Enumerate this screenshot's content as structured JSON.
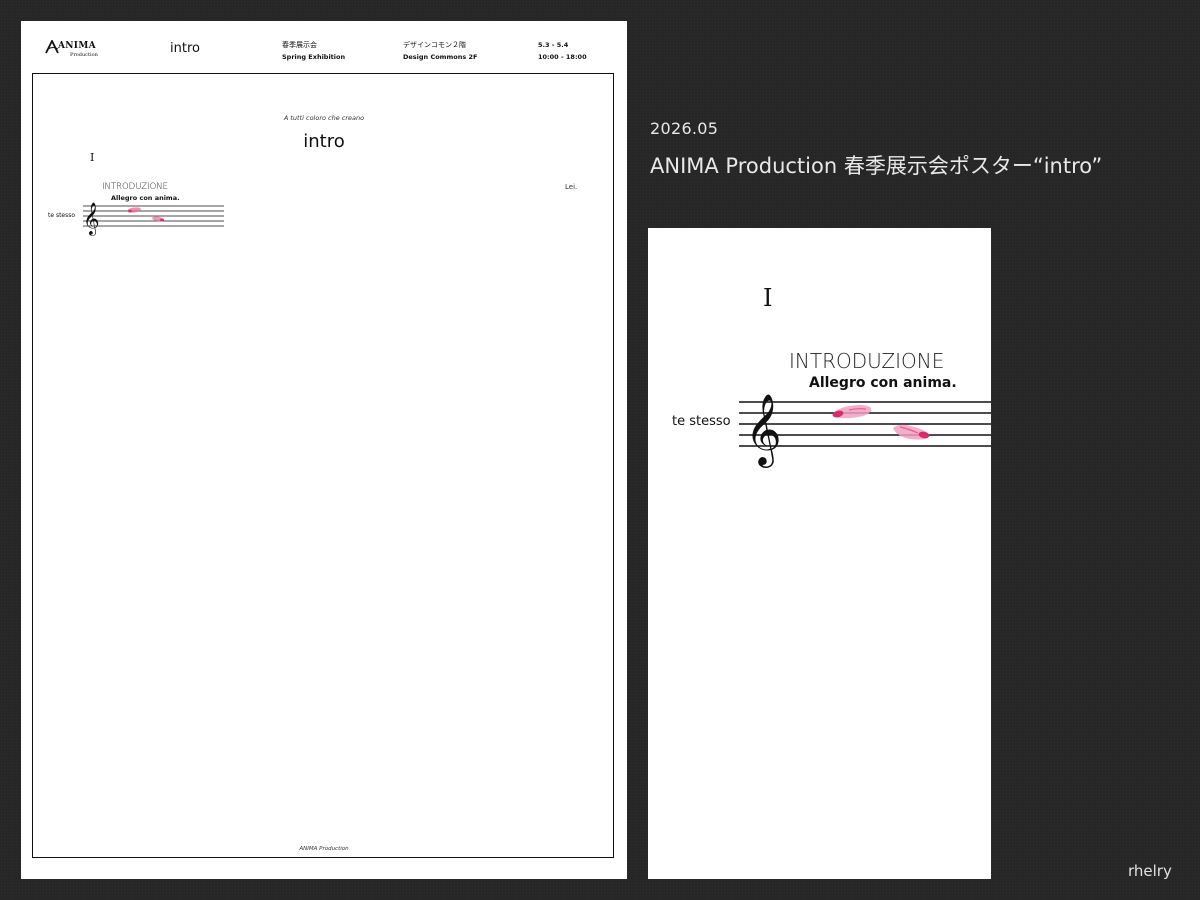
{
  "poster": {
    "brand_name": "ANIMA",
    "brand_sub": "Production",
    "header_title": "intro",
    "event_jp": "春季展示会",
    "event_en": "Spring Exhibition",
    "venue_jp": "デザインコモン２階",
    "venue_en": "Design Commons 2F",
    "dates": "5.3 - 5.4",
    "hours": "10:00 - 18:00",
    "dedication": "A tutti coloro che creano",
    "title": "intro",
    "movement_number": "I",
    "movement_title": "INTRODUZIONE",
    "tempo": "Allegro con anima.",
    "instrument": "te stesso",
    "composer": "Lei.",
    "footer": "ANIMA Production"
  },
  "side_info": {
    "date": "2026.05",
    "title": "ANIMA Production 春季展示会ポスター“intro”"
  },
  "detail": {
    "movement_number": "I",
    "movement_title": "INTRODUZIONE",
    "tempo": "Allegro con anima.",
    "instrument": "te stesso"
  },
  "signature": "rhelry",
  "colors": {
    "background": "#262626",
    "paper": "#ffffff",
    "ink": "#111111",
    "note_pink": "#e0457b"
  },
  "icons": [
    "anima-logo-icon",
    "treble-clef-icon",
    "pink-note-icon"
  ]
}
